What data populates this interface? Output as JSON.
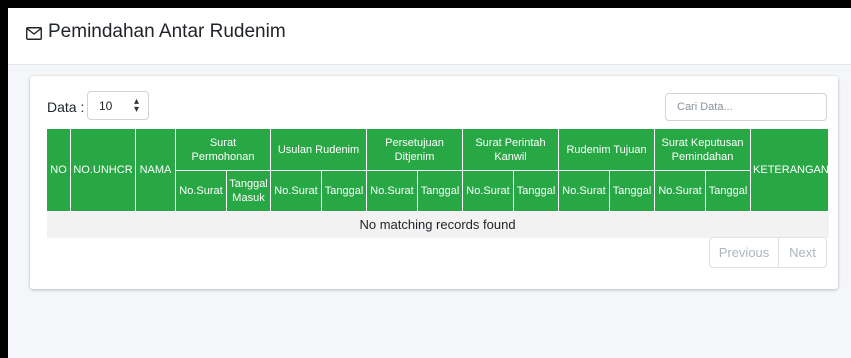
{
  "header": {
    "title": "Pemindahan Antar Rudenim",
    "icon": "envelope-icon"
  },
  "controls": {
    "data_label": "Data :",
    "page_size": "10",
    "search_placeholder": "Cari Data..."
  },
  "table": {
    "columns": {
      "no": "NO",
      "unhcr": "NO.UNHCR",
      "nama": "NAMA",
      "surat_permohonan": "Surat Permohonan",
      "usulan_rudenim": "Usulan Rudenim",
      "persetujuan_ditjenim": "Persetujuan Ditjenim",
      "surat_perintah_kanwil": "Surat Perintah Kanwil",
      "rudenim_tujuan": "Rudenim Tujuan",
      "surat_keputusan_pemindahan": "Surat Keputusan Pemindahan",
      "keterangan": "KETERANGAN"
    },
    "subcolumns": {
      "no_surat": "No.Surat",
      "tanggal": "Tanggal",
      "tanggal_masuk": "Tanggal Masuk"
    },
    "empty_message": "No matching records found"
  },
  "pagination": {
    "previous": "Previous",
    "next": "Next"
  },
  "colors": {
    "header_green": "#28a745",
    "empty_row_bg": "#f2f2f2"
  }
}
